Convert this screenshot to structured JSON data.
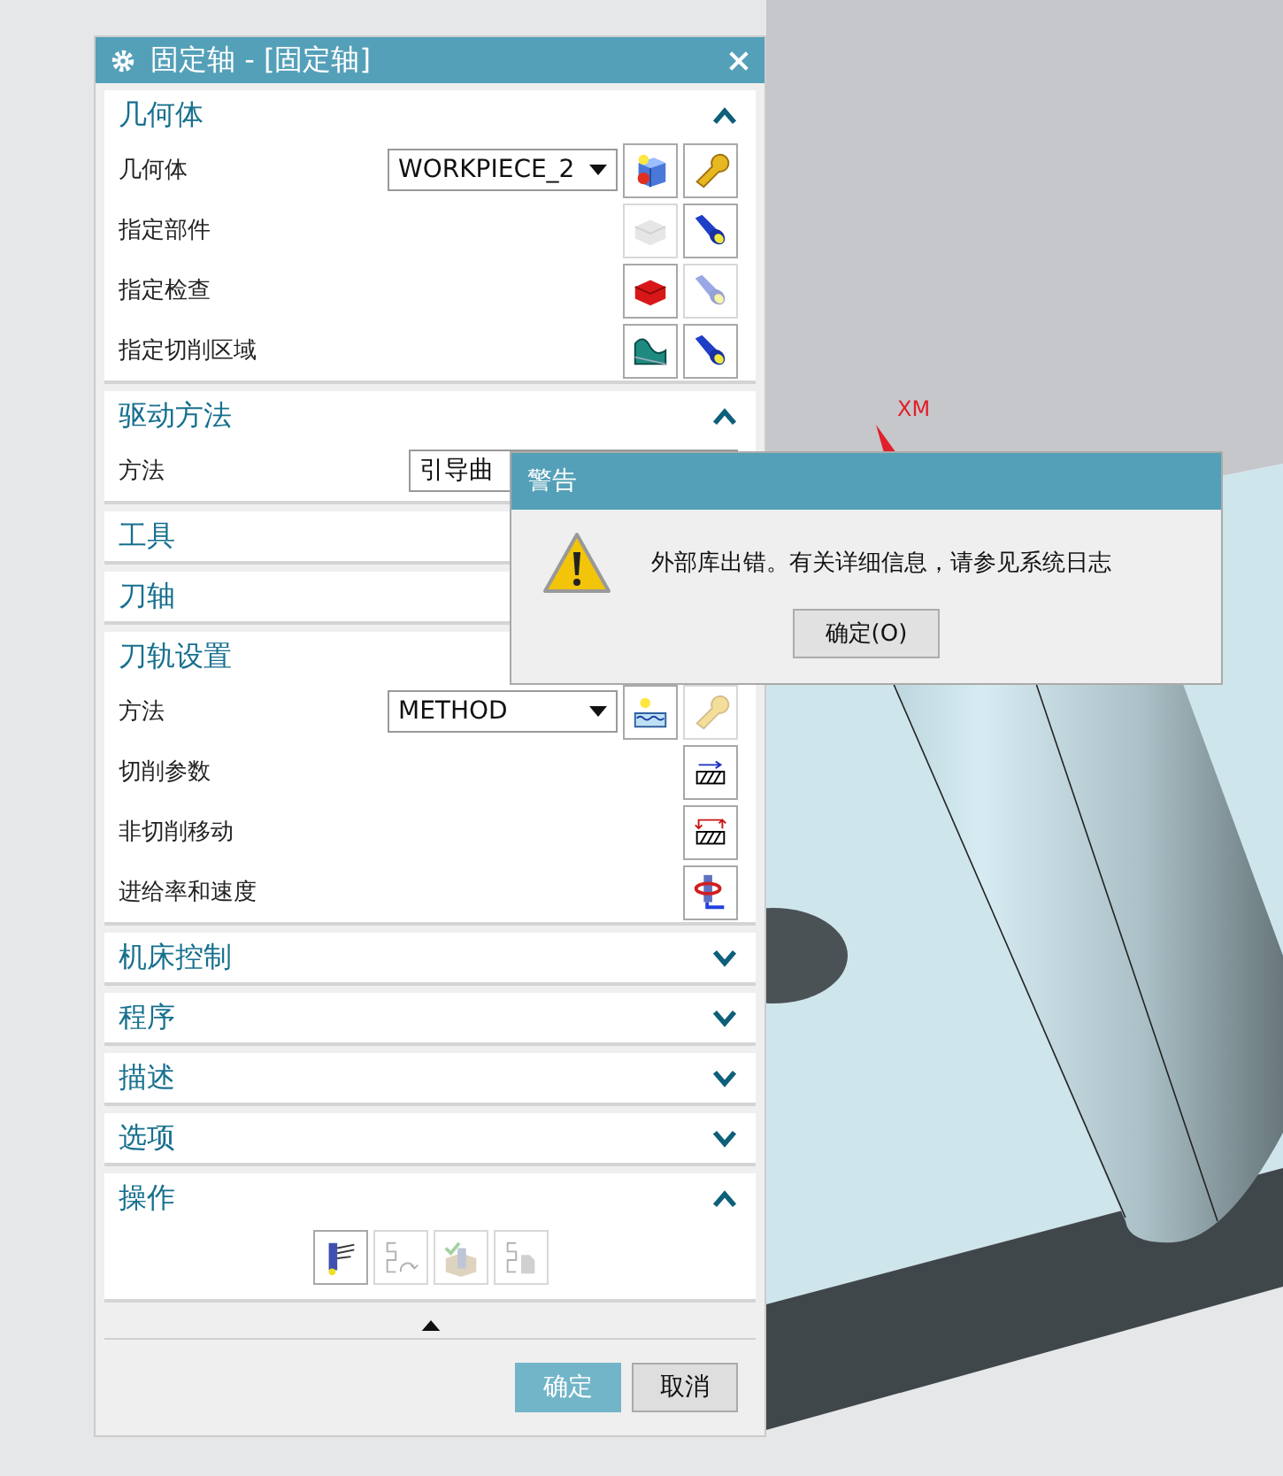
{
  "dialog": {
    "title": "固定轴 - [固定轴]"
  },
  "sections": [
    {
      "title": "几何体",
      "expanded": true,
      "rows": [
        {
          "kind": "dropdown",
          "label": "几何体",
          "value": "WORKPIECE_2",
          "buttons": [
            {
              "kind": "cube",
              "disabled": false
            },
            {
              "kind": "wrench",
              "disabled": false
            }
          ]
        },
        {
          "kind": "action",
          "label": "指定部件",
          "buttons": [
            {
              "kind": "block",
              "disabled": true
            },
            {
              "kind": "flashlight",
              "disabled": false
            }
          ]
        },
        {
          "kind": "action",
          "label": "指定检查",
          "buttons": [
            {
              "kind": "redblock",
              "disabled": false
            },
            {
              "kind": "flashlight",
              "disabled": true
            }
          ]
        },
        {
          "kind": "action",
          "label": "指定切削区域",
          "buttons": [
            {
              "kind": "surface",
              "disabled": false
            },
            {
              "kind": "flashlight",
              "disabled": false
            }
          ]
        }
      ]
    },
    {
      "title": "驱动方法",
      "expanded": true,
      "rows": [
        {
          "kind": "dropdown",
          "label": "方法",
          "value": "引导曲"
        }
      ]
    },
    {
      "title": "工具"
    },
    {
      "title": "刀轴"
    },
    {
      "title": "刀轨设置",
      "expanded": true,
      "rows": [
        {
          "kind": "dropdown",
          "label": "方法",
          "value": "METHOD",
          "buttons": [
            {
              "kind": "waves",
              "disabled": false
            },
            {
              "kind": "wrench",
              "disabled": true
            }
          ]
        },
        {
          "kind": "action",
          "label": "切削参数",
          "buttons": [
            {
              "kind": "hatch",
              "disabled": false
            }
          ]
        },
        {
          "kind": "action",
          "label": "非切削移动",
          "buttons": [
            {
              "kind": "hatcharrows",
              "disabled": false
            }
          ]
        },
        {
          "kind": "action",
          "label": "进给率和速度",
          "buttons": [
            {
              "kind": "spindle",
              "disabled": false
            }
          ]
        }
      ]
    },
    {
      "title": "机床控制",
      "expanded": false
    },
    {
      "title": "程序",
      "expanded": false
    },
    {
      "title": "描述",
      "expanded": false
    },
    {
      "title": "选项",
      "expanded": false
    },
    {
      "title": "操作",
      "expanded": true,
      "actions": [
        {
          "kind": "generate",
          "disabled": false
        },
        {
          "kind": "replay",
          "disabled": true
        },
        {
          "kind": "verify",
          "disabled": true
        },
        {
          "kind": "list",
          "disabled": true
        }
      ]
    }
  ],
  "footer": [
    {
      "label": "确定",
      "primary": true
    },
    {
      "label": "取消",
      "primary": false
    }
  ],
  "viewport": {
    "axis_label": "XM"
  },
  "alert": {
    "title": "警告",
    "message": "外部库出错。有关详细信息，请参见系统日志",
    "button": "确定(O)"
  }
}
